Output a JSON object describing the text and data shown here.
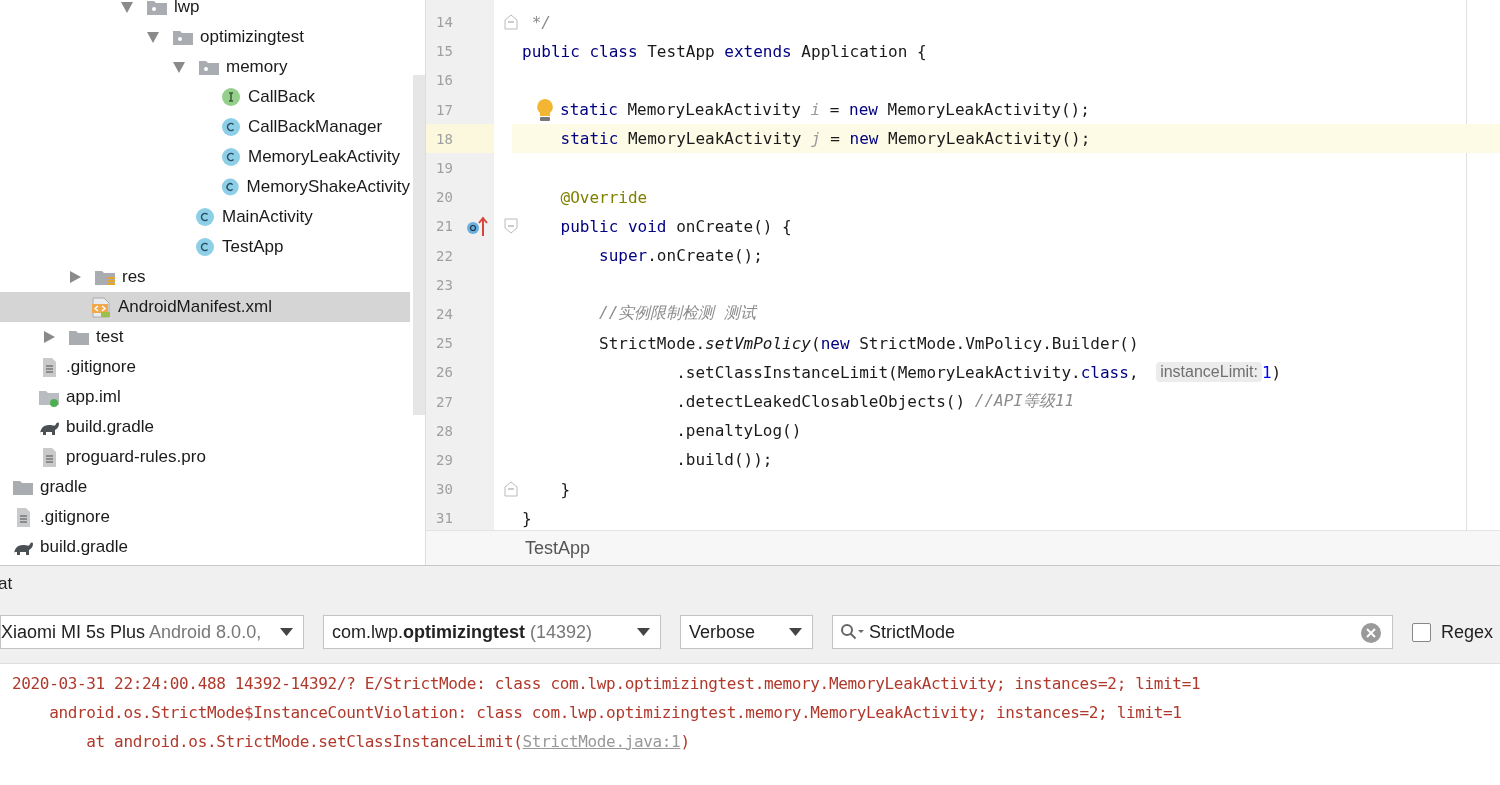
{
  "project_tree": [
    {
      "children": [
        {
          "children": [
            {
              "children": [
                {
                  "children": [
                    {
                      "children": [
                        {
                          "label": "lwp",
                          "kind": "package",
                          "expanded": true,
                          "selected": false,
                          "children": [
                            {
                              "label": "optimizingtest",
                              "kind": "package",
                              "expanded": true,
                              "selected": false,
                              "children": [
                                {
                                  "label": "memory",
                                  "kind": "package",
                                  "expanded": true,
                                  "selected": false,
                                  "children": [
                                    {
                                      "label": "CallBack",
                                      "kind": "interface",
                                      "selected": false
                                    },
                                    {
                                      "label": "CallBackManager",
                                      "kind": "class",
                                      "selected": false
                                    },
                                    {
                                      "label": "MemoryLeakActivity",
                                      "kind": "class",
                                      "selected": false
                                    },
                                    {
                                      "label": "MemoryShakeActivity",
                                      "kind": "class",
                                      "selected": false
                                    }
                                  ]
                                },
                                {
                                  "label": "MainActivity",
                                  "kind": "class",
                                  "selected": false
                                },
                                {
                                  "label": "TestApp",
                                  "kind": "class",
                                  "selected": false
                                }
                              ]
                            }
                          ]
                        }
                      ]
                    }
                  ]
                },
                {
                  "label": "res",
                  "kind": "res-folder",
                  "expanded": false,
                  "selected": false
                },
                {
                  "label": "AndroidManifest.xml",
                  "kind": "manifest",
                  "selected": true
                }
              ]
            },
            {
              "label": "test",
              "kind": "folder",
              "expanded": false,
              "selected": false
            }
          ]
        },
        {
          "label": ".gitignore",
          "kind": "text-file",
          "selected": false
        },
        {
          "label": "app.iml",
          "kind": "module-file",
          "selected": false
        },
        {
          "label": "build.gradle",
          "kind": "gradle",
          "selected": false
        },
        {
          "label": "proguard-rules.pro",
          "kind": "text-file",
          "selected": false
        }
      ]
    },
    {
      "label": "gradle",
      "kind": "folder",
      "selected": false
    },
    {
      "label": ".gitignore",
      "kind": "text-file",
      "selected": false
    },
    {
      "label": "build.gradle",
      "kind": "gradle",
      "selected": false
    }
  ],
  "editor": {
    "lines": [
      {
        "number": "14",
        "current": false,
        "fold_end": true,
        "tokens": [
          {
            "text": " */",
            "kind": "comment"
          }
        ]
      },
      {
        "number": "15",
        "current": false,
        "tokens": [
          {
            "text": "public class",
            "kind": "keyword"
          },
          {
            "text": " TestApp ",
            "kind": "plain"
          },
          {
            "text": "extends",
            "kind": "keyword"
          },
          {
            "text": " Application {",
            "kind": "plain"
          }
        ]
      },
      {
        "number": "16",
        "current": false
      },
      {
        "number": "17",
        "current": false,
        "lightbulb": true,
        "tokens": [
          {
            "text": "static",
            "kind": "keyword"
          },
          {
            "text": " MemoryLeakActivity ",
            "kind": "plain"
          },
          {
            "text": "i",
            "kind": "unused"
          },
          {
            "text": " = ",
            "kind": "plain"
          },
          {
            "text": "new",
            "kind": "keyword"
          },
          {
            "text": " MemoryLeakActivity();",
            "kind": "plain"
          }
        ]
      },
      {
        "number": "18",
        "current": true,
        "tokens": [
          {
            "text": "    static",
            "kind": "keyword"
          },
          {
            "text": " MemoryLeakActivity ",
            "kind": "plain"
          },
          {
            "text": "j",
            "kind": "unused"
          },
          {
            "text": " = ",
            "kind": "plain"
          },
          {
            "text": "new",
            "kind": "keyword"
          },
          {
            "text": " MemoryLeakActivity();",
            "kind": "plain"
          }
        ]
      },
      {
        "number": "19",
        "current": false
      },
      {
        "number": "20",
        "current": false,
        "tokens": [
          {
            "text": "    @Override",
            "kind": "annotation"
          }
        ]
      },
      {
        "number": "21",
        "current": false,
        "override_marker": true,
        "fold_start": true,
        "tokens": [
          {
            "text": "    public void",
            "kind": "keyword"
          },
          {
            "text": " onCreate() {",
            "kind": "plain"
          }
        ]
      },
      {
        "number": "22",
        "current": false,
        "tokens": [
          {
            "text": "        super",
            "kind": "keyword"
          },
          {
            "text": ".onCreate();",
            "kind": "plain"
          }
        ]
      },
      {
        "number": "23",
        "current": false
      },
      {
        "number": "24",
        "current": false,
        "tokens": [
          {
            "text": "        //实例限制检测 测试",
            "kind": "comment"
          }
        ]
      },
      {
        "number": "25",
        "current": false,
        "tokens": [
          {
            "text": "        StrictMode.",
            "kind": "plain"
          },
          {
            "text": "setVmPolicy",
            "kind": "static-call"
          },
          {
            "text": "(",
            "kind": "plain"
          },
          {
            "text": "new",
            "kind": "keyword"
          },
          {
            "text": " StrictMode.VmPolicy.Builder()",
            "kind": "plain"
          }
        ]
      },
      {
        "number": "26",
        "current": false,
        "tokens": [
          {
            "text": "                .setClassInstanceLimit(MemoryLeakActivity.",
            "kind": "plain"
          },
          {
            "text": "class",
            "kind": "keyword"
          },
          {
            "text": ", ",
            "kind": "plain"
          },
          {
            "text": "instanceLimit:",
            "kind": "hint"
          },
          {
            "text": "1",
            "kind": "number"
          },
          {
            "text": ")",
            "kind": "plain"
          }
        ]
      },
      {
        "number": "27",
        "current": false,
        "tokens": [
          {
            "text": "                .detectLeakedClosableObjects() ",
            "kind": "plain"
          },
          {
            "text": "//API等级11",
            "kind": "comment"
          }
        ]
      },
      {
        "number": "28",
        "current": false,
        "tokens": [
          {
            "text": "                .penaltyLog()",
            "kind": "plain"
          }
        ]
      },
      {
        "number": "29",
        "current": false,
        "tokens": [
          {
            "text": "                .build());",
            "kind": "plain"
          }
        ]
      },
      {
        "number": "30",
        "current": false,
        "fold_end": true,
        "tokens": [
          {
            "text": "    }",
            "kind": "plain"
          }
        ]
      },
      {
        "number": "31",
        "current": false,
        "tokens": [
          {
            "text": "}",
            "kind": "plain"
          }
        ]
      }
    ],
    "breadcrumb": "TestApp"
  },
  "logcat": {
    "title": "at",
    "device": {
      "name": "Xiaomi MI 5s Plus",
      "detail": "Android 8.0.0,"
    },
    "process": {
      "name": "com.lwp.**optimizingtest**",
      "detail": "(14392)"
    },
    "level": "Verbose",
    "search": {
      "value": "StrictMode"
    },
    "regex": {
      "label": "Regex",
      "checked": false
    },
    "lines": [
      {
        "text": "2020-03-31 22:24:00.488 14392-14392/? E/StrictMode: class com.lwp.optimizingtest.memory.MemoryLeakActivity; instances=2; limit=1"
      },
      {
        "text": "    android.os.StrictMode$InstanceCountViolation: class com.lwp.optimizingtest.memory.MemoryLeakActivity; instances=2; limit=1"
      },
      {
        "text": "        at android.os.StrictMode.setClassInstanceLimit(",
        "link": "StrictMode.java:1",
        "after": ")"
      }
    ]
  }
}
